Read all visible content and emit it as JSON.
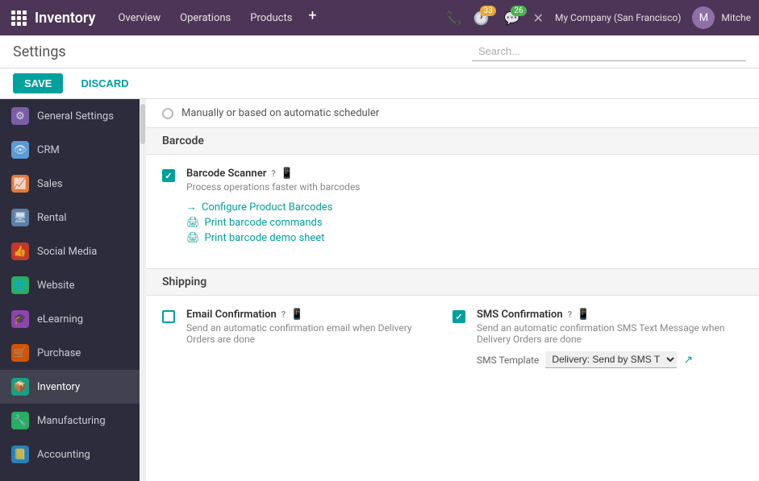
{
  "topnav": {
    "brand": "Inventory",
    "links": [
      "Overview",
      "Operations",
      "Products"
    ],
    "add_label": "+",
    "phone_icon": "📞",
    "clock_badge": "33",
    "chat_badge": "26",
    "close_icon": "✕",
    "company": "My Company (San Francisco)",
    "username": "Mitche"
  },
  "subheader": {
    "title": "Settings",
    "search_placeholder": "Search..."
  },
  "buttons": {
    "save": "SAVE",
    "discard": "DISCARD"
  },
  "sidebar": {
    "items": [
      {
        "id": "general-settings",
        "label": "General Settings",
        "icon_class": "icon-gear",
        "icon": "⚙"
      },
      {
        "id": "crm",
        "label": "CRM",
        "icon_class": "icon-eye",
        "icon": "👁"
      },
      {
        "id": "sales",
        "label": "Sales",
        "icon_class": "icon-sales",
        "icon": "📈"
      },
      {
        "id": "rental",
        "label": "Rental",
        "icon_class": "icon-rental",
        "icon": "🖥"
      },
      {
        "id": "social-media",
        "label": "Social Media",
        "icon_class": "icon-social",
        "icon": "👍"
      },
      {
        "id": "website",
        "label": "Website",
        "icon_class": "icon-website",
        "icon": "🌐"
      },
      {
        "id": "elearning",
        "label": "eLearning",
        "icon_class": "icon-elearning",
        "icon": "🎓"
      },
      {
        "id": "purchase",
        "label": "Purchase",
        "icon_class": "icon-purchase",
        "icon": "🛒"
      },
      {
        "id": "inventory",
        "label": "Inventory",
        "icon_class": "icon-inventory",
        "icon": "📦",
        "active": true
      },
      {
        "id": "manufacturing",
        "label": "Manufacturing",
        "icon_class": "icon-manufacturing",
        "icon": "🔧"
      },
      {
        "id": "accounting",
        "label": "Accounting",
        "icon_class": "icon-accounting",
        "icon": "📒"
      }
    ]
  },
  "content": {
    "top_partial": {
      "text": "Manually or based on automatic scheduler"
    },
    "barcode_section": {
      "title": "Barcode",
      "barcode_scanner": {
        "label": "Barcode Scanner",
        "description": "Process operations faster with barcodes",
        "checked": true,
        "links": [
          {
            "id": "configure-barcodes",
            "text": "Configure Product Barcodes",
            "arrow": "→"
          },
          {
            "id": "print-commands",
            "text": "Print barcode commands",
            "printer": true
          },
          {
            "id": "print-demo",
            "text": "Print barcode demo sheet",
            "printer": true
          }
        ]
      }
    },
    "shipping_section": {
      "title": "Shipping",
      "email_confirmation": {
        "label": "Email Confirmation",
        "description": "Send an automatic confirmation email when Delivery Orders are done",
        "checked": false
      },
      "sms_confirmation": {
        "label": "SMS Confirmation",
        "description": "Send an automatic confirmation SMS Text Message when Delivery Orders are done",
        "checked": true,
        "sms_template_label": "SMS Template",
        "sms_template_value": "Delivery: Send by SMS T"
      }
    }
  }
}
